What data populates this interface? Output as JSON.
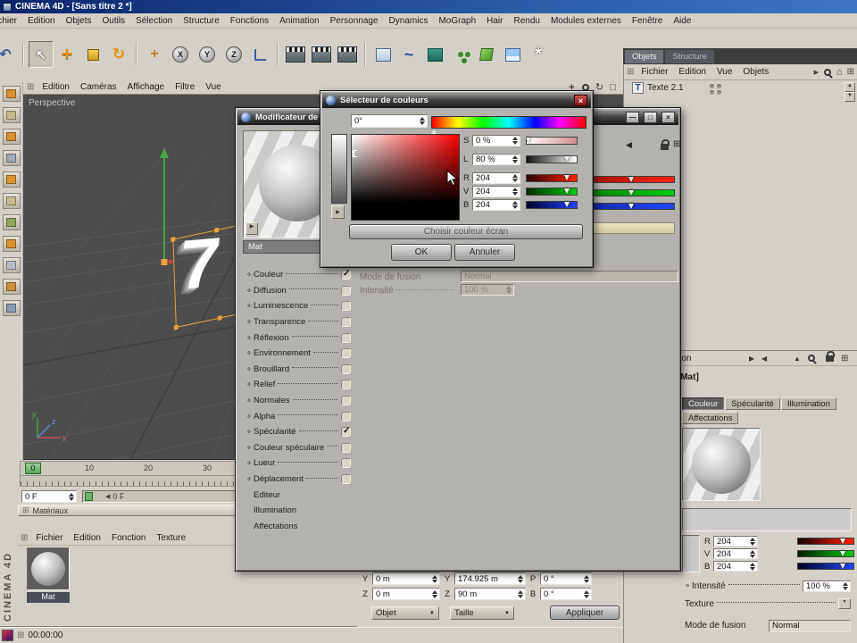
{
  "window": {
    "title": "CINEMA 4D - [Sans titre 2 *]",
    "status_time": "00:00:00",
    "brand_vertical": "CINEMA 4D"
  },
  "menubar": [
    "Fichier",
    "Edition",
    "Objets",
    "Outils",
    "Sélection",
    "Structure",
    "Fonctions",
    "Animation",
    "Personnage",
    "Dynamics",
    "MoGraph",
    "Hair",
    "Rendu",
    "Modules externes",
    "Fenêtre",
    "Aide"
  ],
  "layout_tabs": [
    "Objets",
    "Structure"
  ],
  "toolbar": {
    "axis_locks": [
      "X",
      "Y",
      "Z"
    ]
  },
  "viewport": {
    "menu": [
      "Edition",
      "Caméras",
      "Affichage",
      "Filtre",
      "Vue"
    ],
    "label": "Perspective",
    "object_text": "7",
    "axes": {
      "x": "x",
      "y": "y",
      "z": "z"
    }
  },
  "timeline": {
    "marker": "0",
    "ticks": [
      "10",
      "20",
      "30"
    ],
    "frame": "0 F",
    "range_start": "0 F"
  },
  "materials": {
    "title": "Matériaux",
    "menu": [
      "Fichier",
      "Edition",
      "Fonction",
      "Texture"
    ],
    "name": "Mat"
  },
  "coords": {
    "rows": [
      {
        "c1": "Y",
        "v1": "0 m",
        "c2": "Y",
        "v2": "174.925 m",
        "c3": "P",
        "v3": "0 °"
      },
      {
        "c1": "Z",
        "v1": "0 m",
        "c2": "Z",
        "v2": "90 m",
        "c3": "B",
        "v3": "0 °"
      }
    ],
    "mode1": "Objet",
    "mode2": "Taille",
    "apply": "Appliquer"
  },
  "object_manager": {
    "menu": [
      "Fichier",
      "Edition",
      "Vue",
      "Objets"
    ],
    "item": "Texte 2.1"
  },
  "attributes": {
    "header_menu": "Édition",
    "subject": "Matériau [Mat]",
    "tabs_row1": [
      "Couleur",
      "Spécularité",
      "Illumination"
    ],
    "tabs_row2": [
      "Affectations"
    ],
    "color": {
      "rows": [
        {
          "label": "R",
          "value": "204"
        },
        {
          "label": "V",
          "value": "204"
        },
        {
          "label": "B",
          "value": "204"
        }
      ],
      "intensity_label": "Intensité",
      "intensity_value": "100 %",
      "texture_label": "Texture",
      "blend_label": "Mode de fusion",
      "blend_value": "Normal",
      "swatch_hex": "#cccccc"
    }
  },
  "material_editor": {
    "title": "Modificateur de matériaux",
    "name": "Mat",
    "channels": [
      {
        "label": "Couleur",
        "has_checkbox": true,
        "checked": true
      },
      {
        "label": "Diffusion",
        "has_checkbox": true,
        "checked": false
      },
      {
        "label": "Luminescence",
        "has_checkbox": true,
        "checked": false
      },
      {
        "label": "Transparence",
        "has_checkbox": true,
        "checked": false
      },
      {
        "label": "Réflexion",
        "has_checkbox": true,
        "checked": false
      },
      {
        "label": "Environnement",
        "has_checkbox": true,
        "checked": false
      },
      {
        "label": "Brouillard",
        "has_checkbox": true,
        "checked": false
      },
      {
        "label": "Relief",
        "has_checkbox": true,
        "checked": false
      },
      {
        "label": "Normales",
        "has_checkbox": true,
        "checked": false
      },
      {
        "label": "Alpha",
        "has_checkbox": true,
        "checked": false
      },
      {
        "label": "Spécularité",
        "has_checkbox": true,
        "checked": true
      },
      {
        "label": "Couleur spéculaire",
        "has_checkbox": true,
        "checked": false
      },
      {
        "label": "Lueur",
        "has_checkbox": true,
        "checked": false
      },
      {
        "label": "Déplacement",
        "has_checkbox": true,
        "checked": false
      },
      {
        "label": "Editeur",
        "has_checkbox": false,
        "checked": false
      },
      {
        "label": "Illumination",
        "has_checkbox": false,
        "checked": false
      },
      {
        "label": "Affectations",
        "has_checkbox": false,
        "checked": false
      }
    ],
    "disabled": {
      "blend_label": "Mode de fusion",
      "blend_value": "Normal",
      "intensity_label": "Intensité",
      "intensity_value": "100 %"
    }
  },
  "color_picker": {
    "title": "Sélecteur de couleurs",
    "hue_field": "0°",
    "rows": [
      {
        "label": "S",
        "value": "0 %"
      },
      {
        "label": "L",
        "value": "80 %"
      },
      {
        "label": "R",
        "value": "204"
      },
      {
        "label": "V",
        "value": "204"
      },
      {
        "label": "B",
        "value": "204"
      }
    ],
    "screen_pick": "Choisir couleur écran",
    "ok": "OK",
    "cancel": "Annuler"
  },
  "icons": {
    "grip": "⊞",
    "home": "⌂",
    "play": "▶",
    "prev": "◀",
    "up": "▲",
    "down": "▼",
    "rotate": "↻",
    "undo": "↶",
    "cursor_tool": "↖",
    "pan": "+",
    "box": "□",
    "star": "*",
    "wave": "~",
    "close": "×",
    "minimize": "—",
    "maximize": "□",
    "text_object": "T"
  }
}
